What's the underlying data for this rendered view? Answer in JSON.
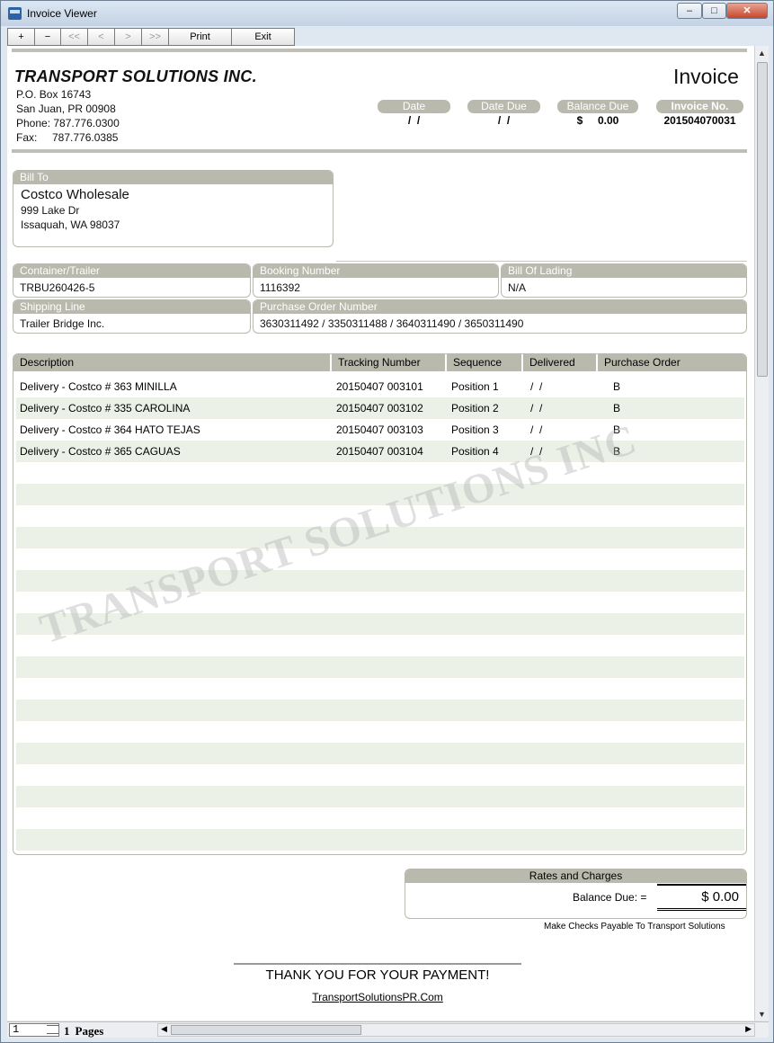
{
  "window": {
    "title": "Invoice Viewer"
  },
  "toolbar": {
    "zoom_in": "+",
    "zoom_out": "−",
    "first": "<<",
    "prev": "<",
    "next": ">",
    "last": ">>",
    "print": "Print",
    "exit": "Exit"
  },
  "company": {
    "name": "TRANSPORT SOLUTIONS INC.",
    "po_box": "P.O. Box 16743",
    "city": "San Juan, PR 00908",
    "phone": "Phone: 787.776.0300",
    "fax": "Fax:     787.776.0385"
  },
  "invoice": {
    "title": "Invoice",
    "date_label": "Date",
    "date_value": "/  /",
    "due_label": "Date Due",
    "due_value": "/  /",
    "balance_label": "Balance Due",
    "balance_value": "$     0.00",
    "number_label": "Invoice No.",
    "number_value": "201504070031"
  },
  "bill_to": {
    "label": "Bill To",
    "name": "Costco Wholesale",
    "street": "999 Lake Dr",
    "city": "Issaquah, WA 98037"
  },
  "shipment": {
    "container_label": "Container/Trailer",
    "container_value": "TRBU260426-5",
    "booking_label": "Booking Number",
    "booking_value": "1116392",
    "lading_label": "Bill Of Lading",
    "lading_value": "N/A",
    "line_label": "Shipping Line",
    "line_value": "Trailer Bridge Inc.",
    "po_label": "Purchase Order Number",
    "po_value": "3630311492 / 3350311488 / 3640311490 / 3650311490"
  },
  "lines": {
    "headers": [
      "Description",
      "Tracking Number",
      "Sequence",
      "Delivered",
      "Purchase Order"
    ],
    "rows": [
      [
        "Delivery - Costco # 363 MINILLA",
        "20150407 003101",
        "Position 1",
        "/  /",
        "B"
      ],
      [
        "Delivery - Costco # 335 CAROLINA",
        "20150407 003102",
        "Position 2",
        "/  /",
        "B"
      ],
      [
        "Delivery - Costco # 364 HATO TEJAS",
        "20150407 003103",
        "Position 3",
        "/  /",
        "B"
      ],
      [
        "Delivery - Costco # 365 CAGUAS",
        "20150407 003104",
        "Position 4",
        "/  /",
        "B"
      ]
    ]
  },
  "watermark": "TRANSPORT SOLUTIONS INC",
  "rates": {
    "label": "Rates and Charges",
    "balance_label": "Balance Due: =",
    "balance_value": "$  0.00"
  },
  "footer": {
    "note": "Make Checks Payable To Transport Solutions",
    "thanks": "THANK YOU FOR YOUR PAYMENT!",
    "website": "TransportSolutionsPR.Com"
  },
  "status": {
    "page": "1",
    "pages_count": "1",
    "pages_word": "Pages"
  },
  "colors": {
    "band": "#b9b9ad",
    "stripe": "#ebf1e6",
    "rule": "#bfbfb6"
  }
}
